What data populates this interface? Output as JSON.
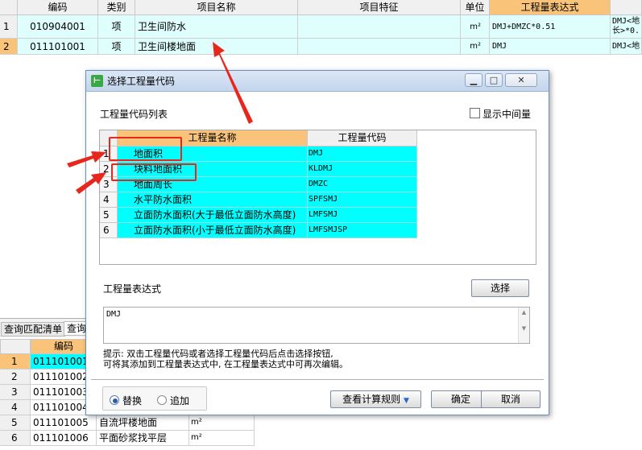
{
  "main_grid": {
    "headers": [
      "编码",
      "类别",
      "项目名称",
      "项目特征",
      "单位",
      "工程量表达式"
    ],
    "rows": [
      {
        "num": "1",
        "code": "010904001",
        "type": "项",
        "name": "卫生间防水",
        "feature": "",
        "unit": "m²",
        "expr": "DMJ+DMZC*0.51",
        "extra": "DMJ<地长>*0."
      },
      {
        "num": "2",
        "code": "011101001",
        "type": "项",
        "name": "卫生间楼地面",
        "feature": "",
        "unit": "m²",
        "expr": "DMJ",
        "extra": "DMJ<地"
      }
    ]
  },
  "bottom_panel": {
    "tabs": [
      "查询匹配清单",
      "查询"
    ],
    "header": "编码",
    "rows": [
      {
        "num": "1",
        "code": "011101001",
        "name": ""
      },
      {
        "num": "2",
        "code": "011101002",
        "name": ""
      },
      {
        "num": "3",
        "code": "011101003",
        "name": ""
      },
      {
        "num": "4",
        "code": "011101004",
        "name": ""
      },
      {
        "num": "5",
        "code": "011101005",
        "name": "自流坪楼地面",
        "unit": "m²"
      },
      {
        "num": "6",
        "code": "011101006",
        "name": "平面砂浆找平层",
        "unit": "m²"
      }
    ]
  },
  "dialog": {
    "title": "选择工程量代码",
    "list_label": "工程量代码列表",
    "show_intermediate": "显示中间量",
    "col_name": "工程量名称",
    "col_code": "工程量代码",
    "items": [
      {
        "num": "1",
        "name": "地面积",
        "code": "DMJ"
      },
      {
        "num": "2",
        "name": "块料地面积",
        "code": "KLDMJ"
      },
      {
        "num": "3",
        "name": "地面周长",
        "code": "DMZC"
      },
      {
        "num": "4",
        "name": "水平防水面积",
        "code": "SPFSMJ"
      },
      {
        "num": "5",
        "name": "立面防水面积(大于最低立面防水高度)",
        "code": "LMFSMJ"
      },
      {
        "num": "6",
        "name": "立面防水面积(小于最低立面防水高度)",
        "code": "LMFSMJSP"
      }
    ],
    "expr_label": "工程量表达式",
    "select_button": "选择",
    "expr_value": "DMJ",
    "hint_line1": "提示: 双击工程量代码或者选择工程量代码后点击选择按钮,",
    "hint_line2": "可将其添加到工程量表达式中, 在工程量表达式中可再次编辑。",
    "radio_replace": "替换",
    "radio_append": "追加",
    "view_rules_button": "查看计算规则",
    "ok_button": "确定",
    "cancel_button": "取消",
    "colors": {
      "highlight": "#00ffff",
      "header": "#f9c47a",
      "annotation": "#e8271c"
    }
  }
}
